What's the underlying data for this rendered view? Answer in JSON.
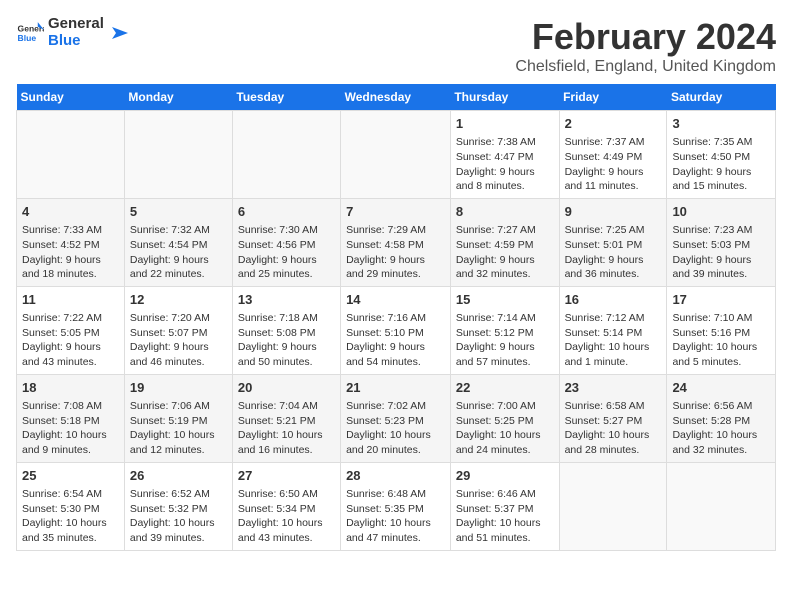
{
  "header": {
    "logo_general": "General",
    "logo_blue": "Blue",
    "title": "February 2024",
    "subtitle": "Chelsfield, England, United Kingdom"
  },
  "days_of_week": [
    "Sunday",
    "Monday",
    "Tuesday",
    "Wednesday",
    "Thursday",
    "Friday",
    "Saturday"
  ],
  "weeks": [
    [
      {
        "day": "",
        "content": ""
      },
      {
        "day": "",
        "content": ""
      },
      {
        "day": "",
        "content": ""
      },
      {
        "day": "",
        "content": ""
      },
      {
        "day": "1",
        "content": "Sunrise: 7:38 AM\nSunset: 4:47 PM\nDaylight: 9 hours and 8 minutes."
      },
      {
        "day": "2",
        "content": "Sunrise: 7:37 AM\nSunset: 4:49 PM\nDaylight: 9 hours and 11 minutes."
      },
      {
        "day": "3",
        "content": "Sunrise: 7:35 AM\nSunset: 4:50 PM\nDaylight: 9 hours and 15 minutes."
      }
    ],
    [
      {
        "day": "4",
        "content": "Sunrise: 7:33 AM\nSunset: 4:52 PM\nDaylight: 9 hours and 18 minutes."
      },
      {
        "day": "5",
        "content": "Sunrise: 7:32 AM\nSunset: 4:54 PM\nDaylight: 9 hours and 22 minutes."
      },
      {
        "day": "6",
        "content": "Sunrise: 7:30 AM\nSunset: 4:56 PM\nDaylight: 9 hours and 25 minutes."
      },
      {
        "day": "7",
        "content": "Sunrise: 7:29 AM\nSunset: 4:58 PM\nDaylight: 9 hours and 29 minutes."
      },
      {
        "day": "8",
        "content": "Sunrise: 7:27 AM\nSunset: 4:59 PM\nDaylight: 9 hours and 32 minutes."
      },
      {
        "day": "9",
        "content": "Sunrise: 7:25 AM\nSunset: 5:01 PM\nDaylight: 9 hours and 36 minutes."
      },
      {
        "day": "10",
        "content": "Sunrise: 7:23 AM\nSunset: 5:03 PM\nDaylight: 9 hours and 39 minutes."
      }
    ],
    [
      {
        "day": "11",
        "content": "Sunrise: 7:22 AM\nSunset: 5:05 PM\nDaylight: 9 hours and 43 minutes."
      },
      {
        "day": "12",
        "content": "Sunrise: 7:20 AM\nSunset: 5:07 PM\nDaylight: 9 hours and 46 minutes."
      },
      {
        "day": "13",
        "content": "Sunrise: 7:18 AM\nSunset: 5:08 PM\nDaylight: 9 hours and 50 minutes."
      },
      {
        "day": "14",
        "content": "Sunrise: 7:16 AM\nSunset: 5:10 PM\nDaylight: 9 hours and 54 minutes."
      },
      {
        "day": "15",
        "content": "Sunrise: 7:14 AM\nSunset: 5:12 PM\nDaylight: 9 hours and 57 minutes."
      },
      {
        "day": "16",
        "content": "Sunrise: 7:12 AM\nSunset: 5:14 PM\nDaylight: 10 hours and 1 minute."
      },
      {
        "day": "17",
        "content": "Sunrise: 7:10 AM\nSunset: 5:16 PM\nDaylight: 10 hours and 5 minutes."
      }
    ],
    [
      {
        "day": "18",
        "content": "Sunrise: 7:08 AM\nSunset: 5:18 PM\nDaylight: 10 hours and 9 minutes."
      },
      {
        "day": "19",
        "content": "Sunrise: 7:06 AM\nSunset: 5:19 PM\nDaylight: 10 hours and 12 minutes."
      },
      {
        "day": "20",
        "content": "Sunrise: 7:04 AM\nSunset: 5:21 PM\nDaylight: 10 hours and 16 minutes."
      },
      {
        "day": "21",
        "content": "Sunrise: 7:02 AM\nSunset: 5:23 PM\nDaylight: 10 hours and 20 minutes."
      },
      {
        "day": "22",
        "content": "Sunrise: 7:00 AM\nSunset: 5:25 PM\nDaylight: 10 hours and 24 minutes."
      },
      {
        "day": "23",
        "content": "Sunrise: 6:58 AM\nSunset: 5:27 PM\nDaylight: 10 hours and 28 minutes."
      },
      {
        "day": "24",
        "content": "Sunrise: 6:56 AM\nSunset: 5:28 PM\nDaylight: 10 hours and 32 minutes."
      }
    ],
    [
      {
        "day": "25",
        "content": "Sunrise: 6:54 AM\nSunset: 5:30 PM\nDaylight: 10 hours and 35 minutes."
      },
      {
        "day": "26",
        "content": "Sunrise: 6:52 AM\nSunset: 5:32 PM\nDaylight: 10 hours and 39 minutes."
      },
      {
        "day": "27",
        "content": "Sunrise: 6:50 AM\nSunset: 5:34 PM\nDaylight: 10 hours and 43 minutes."
      },
      {
        "day": "28",
        "content": "Sunrise: 6:48 AM\nSunset: 5:35 PM\nDaylight: 10 hours and 47 minutes."
      },
      {
        "day": "29",
        "content": "Sunrise: 6:46 AM\nSunset: 5:37 PM\nDaylight: 10 hours and 51 minutes."
      },
      {
        "day": "",
        "content": ""
      },
      {
        "day": "",
        "content": ""
      }
    ]
  ]
}
